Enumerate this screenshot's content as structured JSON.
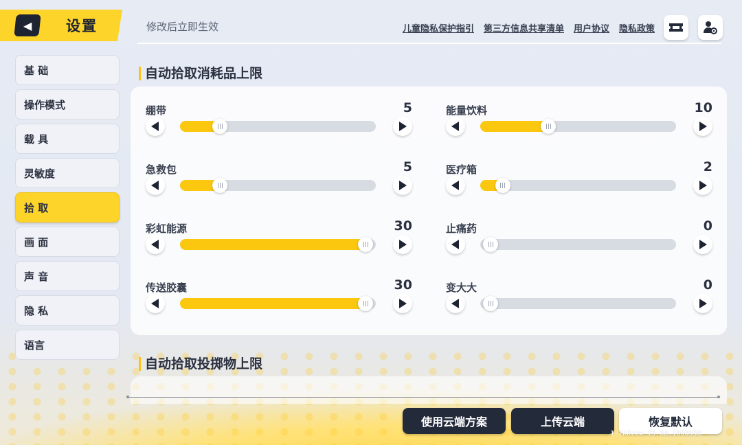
{
  "header": {
    "title": "设置",
    "hint": "修改后立即生效",
    "links": [
      "儿童隐私保护指引",
      "第三方信息共享清单",
      "用户协议",
      "隐私政策"
    ]
  },
  "sidebar": {
    "items": [
      {
        "label": "基 础",
        "active": false
      },
      {
        "label": "操作模式",
        "active": false
      },
      {
        "label": "载 具",
        "active": false
      },
      {
        "label": "灵敏度",
        "active": false
      },
      {
        "label": "拾 取",
        "active": true
      },
      {
        "label": "画 面",
        "active": false
      },
      {
        "label": "声 音",
        "active": false
      },
      {
        "label": "隐 私",
        "active": false
      },
      {
        "label": "语言",
        "active": false
      }
    ]
  },
  "sections": {
    "consumables_title": "自动拾取消耗品上限",
    "throwables_title": "自动拾取投掷物上限"
  },
  "sliders": [
    {
      "label": "绷带",
      "value": "5",
      "fraction": 0.17
    },
    {
      "label": "能量饮料",
      "value": "10",
      "fraction": 0.33
    },
    {
      "label": "急救包",
      "value": "5",
      "fraction": 0.17
    },
    {
      "label": "医疗箱",
      "value": "2",
      "fraction": 0.07
    },
    {
      "label": "彩虹能源",
      "value": "30",
      "fraction": 1.0
    },
    {
      "label": "止痛药",
      "value": "0",
      "fraction": 0.0
    },
    {
      "label": "传送胶囊",
      "value": "30",
      "fraction": 1.0
    },
    {
      "label": "变大大",
      "value": "0",
      "fraction": 0.0
    }
  ],
  "footer": {
    "cloud_plan_label": "使用云端方案",
    "upload_label": "上传云端",
    "reset_label": "恢复默认",
    "version": "1-2k8zxw-15.68.1666958"
  },
  "colors": {
    "accent": "#fdd42a",
    "fill": "#fcc80f",
    "dark_button": "#232a3a"
  },
  "icons": {
    "back": "back-arrow-icon",
    "ticket": "ticket-icon",
    "account_settings": "account-settings-icon"
  }
}
